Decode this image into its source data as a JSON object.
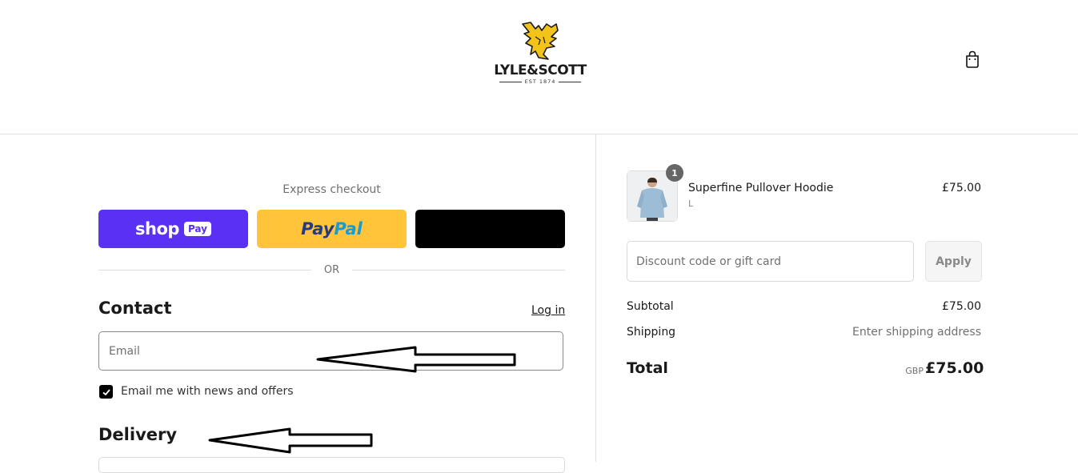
{
  "header": {
    "brand_name": "LYLE&SCOTT",
    "brand_est": "EST 1874",
    "cart_icon": "shopping-bag-icon"
  },
  "express": {
    "label": "Express checkout",
    "shop_pay": {
      "word": "shop",
      "pill": "Pay",
      "color": "#5a31f4"
    },
    "paypal": {
      "part1": "Pay",
      "part2": "Pal",
      "color": "#ffc439"
    },
    "third_button_color": "#000000",
    "or_text": "OR"
  },
  "contact": {
    "heading": "Contact",
    "login_link": "Log in",
    "email_placeholder": "Email",
    "news_checkbox_label": "Email me with news and offers",
    "news_checked": true
  },
  "delivery": {
    "heading": "Delivery"
  },
  "order": {
    "item": {
      "name": "Superfine Pullover Hoodie",
      "variant": "L",
      "price": "£75.00",
      "quantity": "1"
    },
    "discount_placeholder": "Discount code or gift card",
    "apply_label": "Apply",
    "subtotal_label": "Subtotal",
    "subtotal_value": "£75.00",
    "shipping_label": "Shipping",
    "shipping_value": "Enter shipping address",
    "total_label": "Total",
    "total_currency": "GBP",
    "total_value": "£75.00"
  }
}
